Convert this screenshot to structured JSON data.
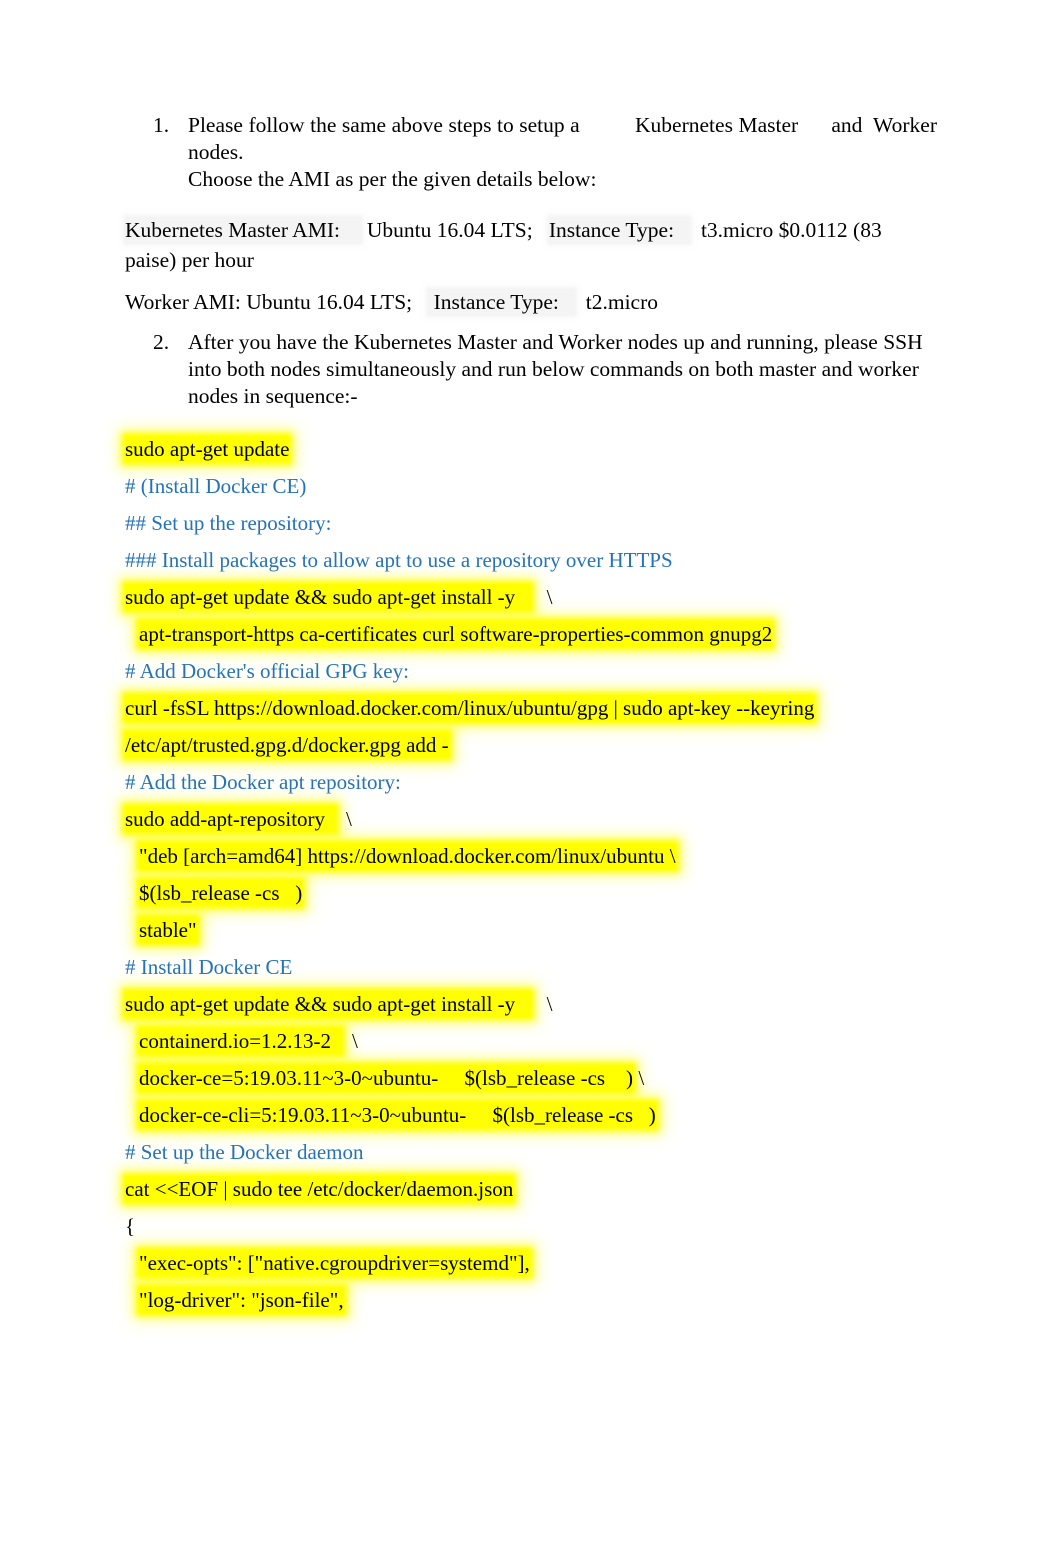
{
  "document": {
    "type": "instructional-document",
    "colors": {
      "body_text": "#000000",
      "comment_text": "#2472b8",
      "highlight_yellow": "#ffff00",
      "highlight_gray": "rgba(0,0,0,0.045)",
      "page_background": "#ffffff"
    },
    "list_items": [
      {
        "number": "1.",
        "lines": [
          "Please follow the same above steps to setup a          Kubernetes Master      and  Worker   nodes.",
          "Choose the AMI as per the given details below:"
        ]
      },
      {
        "number": "2.",
        "lines": [
          "After you have the Kubernetes Master and Worker nodes up and running, please SSH",
          "into both nodes simultaneously and run below commands on both master and worker",
          "nodes in sequence:-"
        ]
      }
    ],
    "ami_paragraphs": [
      {
        "segments": [
          {
            "text": "Kubernetes Master AMI:    ",
            "style": "gray"
          },
          {
            "text": " Ubuntu 16.04 LTS;   ",
            "style": "plain"
          },
          {
            "text": "Instance Type:   ",
            "style": "gray"
          },
          {
            "text": "  t3.micro $0.0112 (83 paise) per hour",
            "style": "plain"
          }
        ]
      },
      {
        "segments": [
          {
            "text": "Worker AMI: Ubuntu 16.04 LTS;   ",
            "style": "plain"
          },
          {
            "text": " Instance Type:   ",
            "style": "gray"
          },
          {
            "text": "  t2.micro",
            "style": "plain"
          }
        ]
      }
    ],
    "code_blocks": [
      {
        "id": "apt-update",
        "kind": "code",
        "lines": [
          {
            "indent": 0,
            "text": "sudo apt-get update",
            "highlight": true
          }
        ]
      },
      {
        "id": "install-docker-ce-header",
        "kind": "comment",
        "text": "# (Install Docker CE)"
      },
      {
        "id": "setup-repository-header",
        "kind": "comment",
        "text": "## Set up the repository:"
      },
      {
        "id": "install-packages-header",
        "kind": "comment",
        "text": "### Install packages to allow apt to use a repository over HTTPS"
      },
      {
        "id": "apt-install-prereqs",
        "kind": "code",
        "lines": [
          {
            "indent": 0,
            "text": "sudo apt-get update && sudo apt-get install -y      \\",
            "highlight": true,
            "hl_text": "sudo apt-get update && sudo apt-get install -y   "
          },
          {
            "indent": 1,
            "text": "apt-transport-https ca-certificates curl software-properties-common gnupg2",
            "highlight": true
          }
        ]
      },
      {
        "id": "add-gpg-key-header",
        "kind": "comment",
        "text": "# Add Docker's official GPG key:"
      },
      {
        "id": "curl-gpg-key",
        "kind": "code",
        "lines": [
          {
            "indent": 0,
            "text": "curl -fsSL https://download.docker.com/linux/ubuntu/gpg | sudo apt-key --keyring",
            "highlight": true
          },
          {
            "indent": 0,
            "text": "/etc/apt/trusted.gpg.d/docker.gpg add -",
            "highlight": true
          }
        ]
      },
      {
        "id": "add-apt-repo-header",
        "kind": "comment",
        "text": "# Add the Docker apt repository:"
      },
      {
        "id": "add-apt-repository",
        "kind": "code",
        "lines": [
          {
            "indent": 0,
            "text": "sudo add-apt-repository    \\",
            "highlight": true,
            "hl_text": "sudo add-apt-repository  "
          },
          {
            "indent": 1,
            "text": "\"deb [arch=amd64] https://download.docker.com/linux/ubuntu \\",
            "highlight": true
          },
          {
            "indent": 1,
            "text": "$(lsb_release -cs    ) \\",
            "highlight": true,
            "hl_text": "$(lsb_release -cs   )"
          },
          {
            "indent": 1,
            "text": "stable\"",
            "highlight": true
          }
        ]
      },
      {
        "id": "install-docker-ce-label",
        "kind": "comment",
        "text": "# Install Docker CE"
      },
      {
        "id": "apt-install-docker",
        "kind": "code",
        "lines": [
          {
            "indent": 0,
            "text": "sudo apt-get update && sudo apt-get install -y      \\",
            "highlight": true,
            "hl_text": "sudo apt-get update && sudo apt-get install -y   "
          },
          {
            "indent": 1,
            "text": "containerd.io=1.2.13-2    \\",
            "highlight": true,
            "hl_text": "containerd.io=1.2.13-2  "
          },
          {
            "indent": 1,
            "text": "docker-ce=5:19.03.11~3-0~ubuntu-     $(lsb_release -cs    ) \\",
            "highlight": true,
            "hl_text": "docker-ce=5:19.03.11~3-0~ubuntu-     $(lsb_release -cs    )"
          },
          {
            "indent": 1,
            "text": "docker-ce-cli=5:19.03.11~3-0~ubuntu-     $(lsb_release -cs   )",
            "highlight": true
          }
        ]
      },
      {
        "id": "setup-daemon-header",
        "kind": "comment",
        "text": "# Set up the Docker daemon"
      },
      {
        "id": "daemon-json",
        "kind": "code",
        "lines": [
          {
            "indent": 0,
            "text": "cat <<EOF | sudo tee /etc/docker/daemon.json",
            "highlight": true
          },
          {
            "indent": 0,
            "text": "{",
            "highlight": false
          },
          {
            "indent": 1,
            "text": "\"exec-opts\": [\"native.cgroupdriver=systemd\"],",
            "highlight": true
          },
          {
            "indent": 1,
            "text": "\"log-driver\": \"json-file\",",
            "highlight": true
          }
        ]
      }
    ]
  }
}
